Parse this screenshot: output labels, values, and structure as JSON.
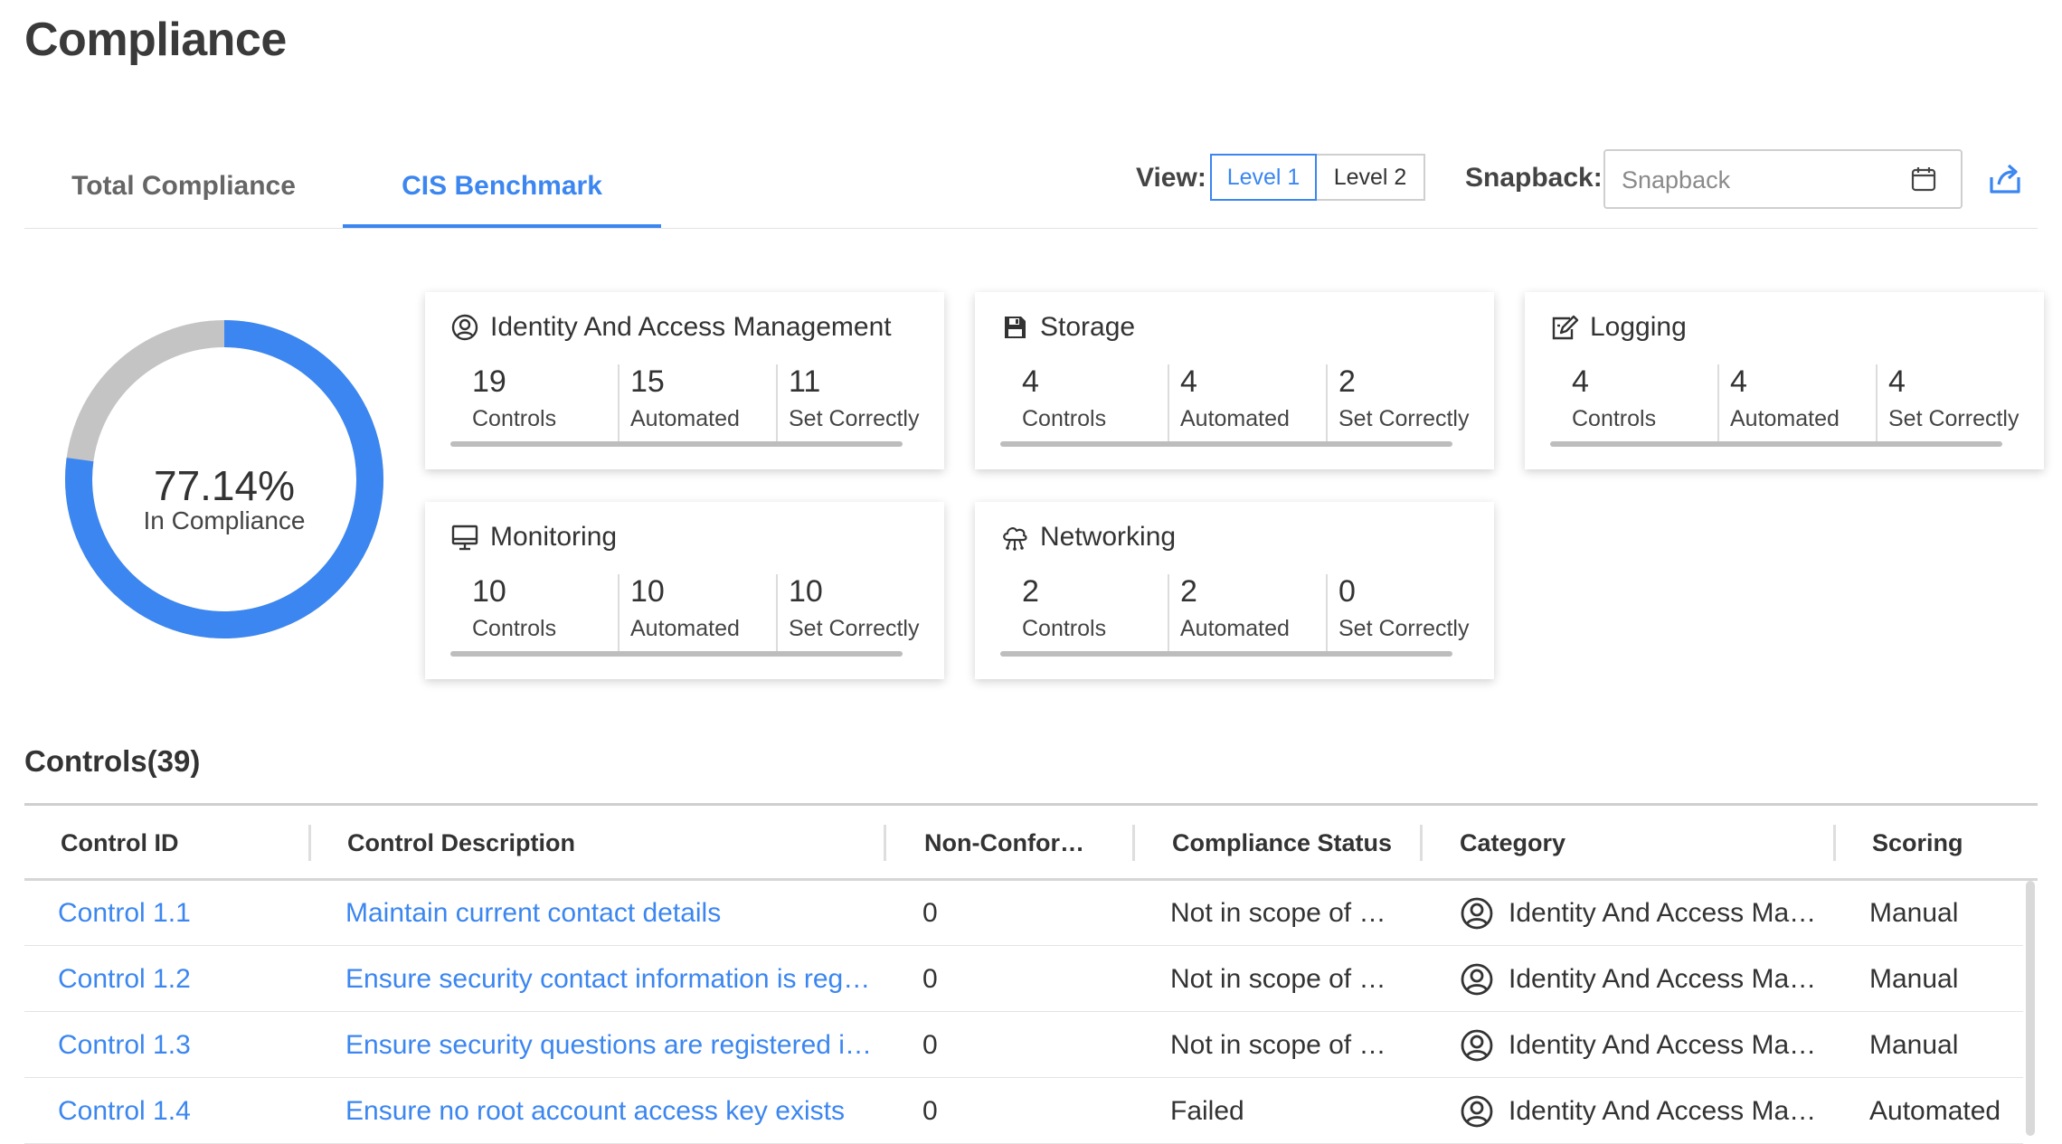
{
  "page": {
    "title": "Compliance"
  },
  "tabs": [
    {
      "label": "Total Compliance",
      "active": false
    },
    {
      "label": "CIS Benchmark",
      "active": true
    }
  ],
  "view": {
    "label": "View:",
    "options": [
      "Level 1",
      "Level 2"
    ],
    "selected": "Level 1"
  },
  "snapback": {
    "label": "Snapback:",
    "placeholder": "Snapback"
  },
  "summary": {
    "percent": "77.14%",
    "percent_value": 77.14,
    "label": "In Compliance"
  },
  "stat_labels": {
    "controls": "Controls",
    "automated": "Automated",
    "set_correctly": "Set Correctly"
  },
  "categories": [
    {
      "name": "Identity And Access Management",
      "icon": "user-circle-icon",
      "controls": "19",
      "automated": "15",
      "set_correctly": "11"
    },
    {
      "name": "Storage",
      "icon": "floppy-disk-icon",
      "controls": "4",
      "automated": "4",
      "set_correctly": "2"
    },
    {
      "name": "Logging",
      "icon": "edit-log-icon",
      "controls": "4",
      "automated": "4",
      "set_correctly": "4"
    },
    {
      "name": "Monitoring",
      "icon": "monitor-icon",
      "controls": "10",
      "automated": "10",
      "set_correctly": "10"
    },
    {
      "name": "Networking",
      "icon": "cloud-network-icon",
      "controls": "2",
      "automated": "2",
      "set_correctly": "0"
    }
  ],
  "controls": {
    "title": "Controls(39)",
    "columns": [
      "Control ID",
      "Control Description",
      "Non-Confor…",
      "Compliance Status",
      "Category",
      "Scoring"
    ],
    "rows": [
      {
        "id": "Control 1.1",
        "description": "Maintain current contact details",
        "non_conforming": "0",
        "status": "Not in scope of …",
        "category": "Identity And Access Ma…",
        "scoring": "Manual"
      },
      {
        "id": "Control 1.2",
        "description": "Ensure security contact information is reg…",
        "non_conforming": "0",
        "status": "Not in scope of …",
        "category": "Identity And Access Ma…",
        "scoring": "Manual"
      },
      {
        "id": "Control 1.3",
        "description": "Ensure security questions are registered i…",
        "non_conforming": "0",
        "status": "Not in scope of …",
        "category": "Identity And Access Ma…",
        "scoring": "Manual"
      },
      {
        "id": "Control 1.4",
        "description": "Ensure no root account access key exists",
        "non_conforming": "0",
        "status": "Failed",
        "category": "Identity And Access Ma…",
        "scoring": "Automated"
      }
    ]
  },
  "colors": {
    "accent": "#3b86f0",
    "donut_remainder": "#c4c4c4",
    "text": "#333333"
  }
}
